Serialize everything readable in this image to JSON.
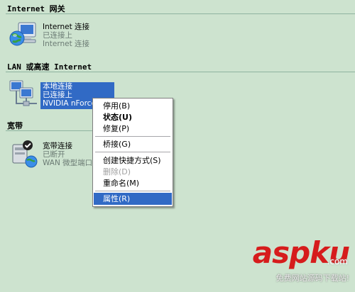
{
  "sections": {
    "internet_gateway": "Internet 网关",
    "lan": "LAN 或高速 Internet",
    "broadband": "宽带"
  },
  "internet_conn": {
    "name": "Internet 连接",
    "status": "已连接上",
    "type": "Internet 连接"
  },
  "local_conn": {
    "name": "本地连接",
    "status": "已连接上",
    "device": "NVIDIA nForce"
  },
  "broadband_conn": {
    "name": "宽带连接",
    "status": "已断开",
    "type": "WAN 微型端口"
  },
  "context_menu": {
    "disable": "停用(B)",
    "status": "状态(U)",
    "repair": "修复(P)",
    "bridge": "桥接(G)",
    "create_shortcut": "创建快捷方式(S)",
    "delete": "删除(D)",
    "rename": "重命名(M)",
    "properties": "属性(R)"
  },
  "watermark": {
    "logo": "aspku",
    "dotcom": ".com",
    "subtitle": "免费网站源码下载站!"
  },
  "colors": {
    "background": "#cde3cf",
    "selection": "#316ac5",
    "watermark": "#d61c1c"
  }
}
